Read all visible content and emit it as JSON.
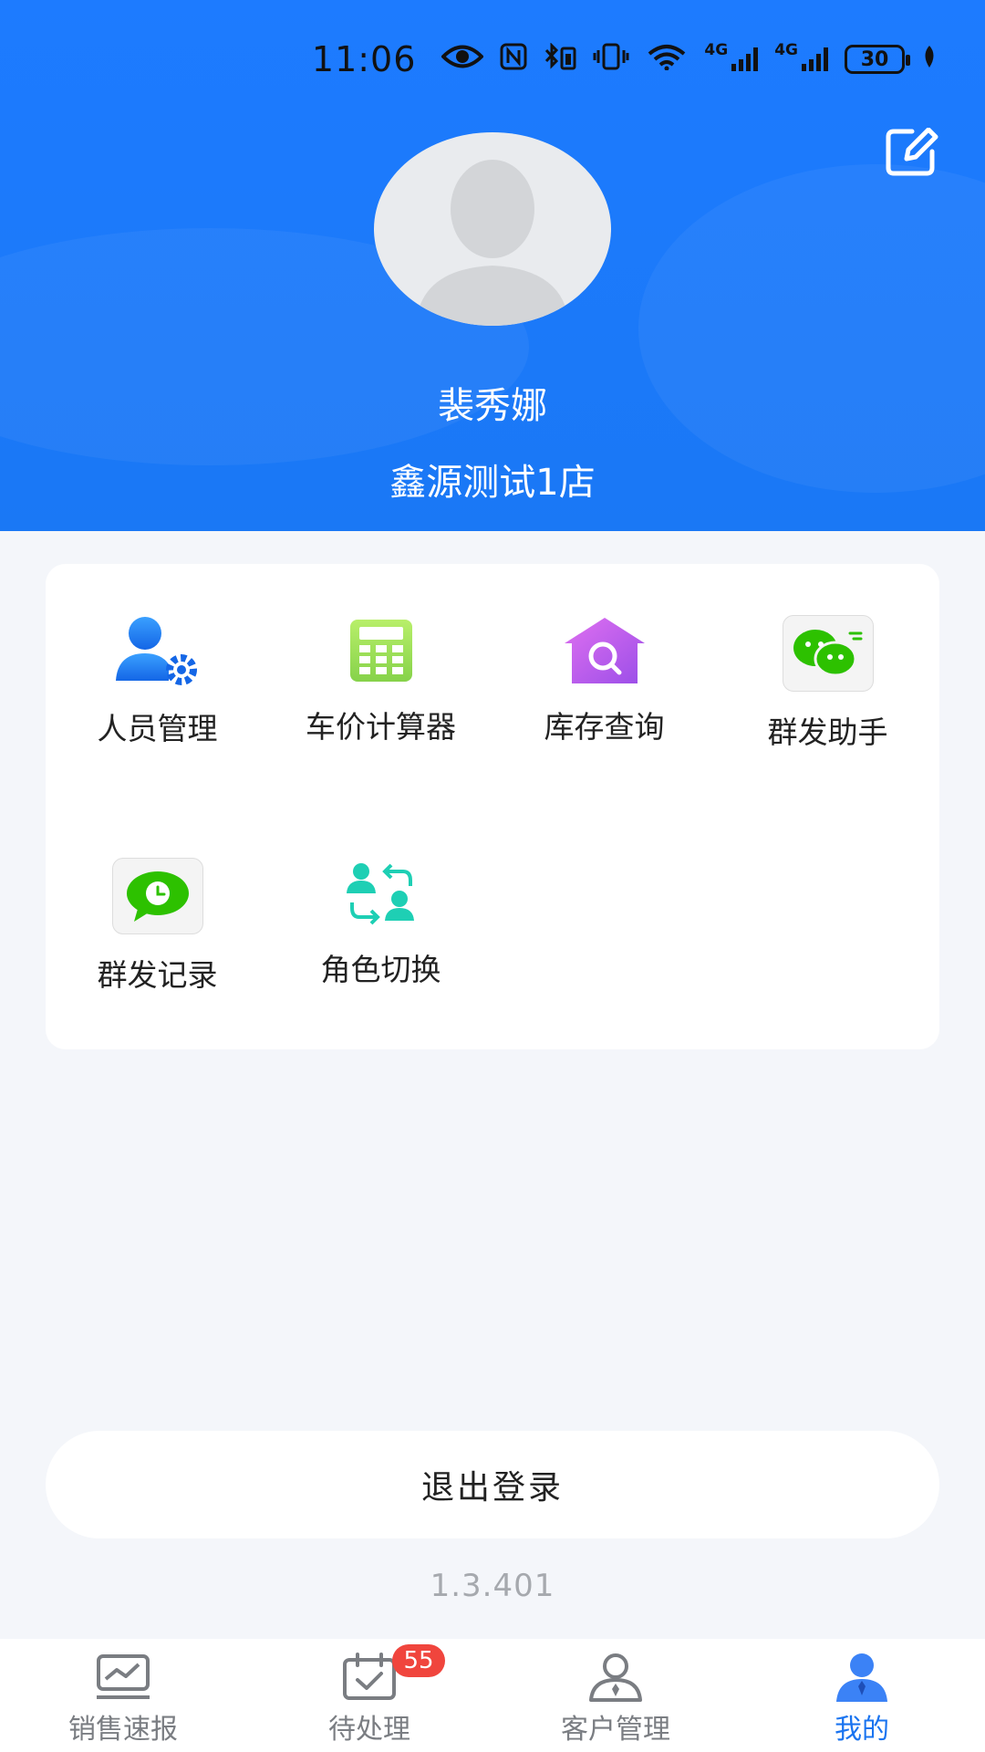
{
  "status_bar": {
    "time": "11:06",
    "network_1": "4G",
    "network_2": "4G",
    "battery": "30"
  },
  "profile": {
    "name": "裴秀娜",
    "store": "鑫源测试1店"
  },
  "menu": {
    "items": [
      {
        "label": "人员管理",
        "icon": "user-settings-icon"
      },
      {
        "label": "车价计算器",
        "icon": "calculator-icon"
      },
      {
        "label": "库存查询",
        "icon": "warehouse-search-icon"
      },
      {
        "label": "群发助手",
        "icon": "wechat-icon"
      },
      {
        "label": "群发记录",
        "icon": "message-clock-icon"
      },
      {
        "label": "角色切换",
        "icon": "role-switch-icon"
      }
    ]
  },
  "logout_label": "退出登录",
  "version": "1.3.401",
  "tabbar": {
    "tabs": [
      {
        "label": "销售速报",
        "icon": "chart-monitor-icon"
      },
      {
        "label": "待处理",
        "icon": "calendar-check-icon",
        "badge": "55"
      },
      {
        "label": "客户管理",
        "icon": "customer-icon"
      },
      {
        "label": "我的",
        "icon": "profile-icon",
        "active": true
      }
    ]
  },
  "colors": {
    "header_blue": "#1d7bff",
    "active_tab": "#1a74f0",
    "badge_red": "#f0453d",
    "wechat_green": "#2dc100",
    "teal": "#1ecfb4",
    "purple": "#c063f0"
  }
}
